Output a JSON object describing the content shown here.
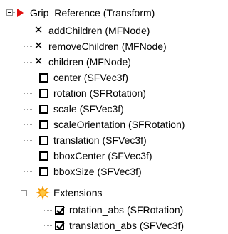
{
  "root": {
    "label": "Grip_Reference (Transform)",
    "icon": "red-triangle-icon",
    "color": "#e01010",
    "expanded": true
  },
  "x_fields": [
    {
      "label": "addChildren (MFNode)",
      "icon": "x-icon"
    },
    {
      "label": "removeChildren (MFNode)",
      "icon": "x-icon"
    },
    {
      "label": "children (MFNode)",
      "icon": "x-icon"
    }
  ],
  "fields": [
    {
      "label": "center (SFVec3f)",
      "checked": false
    },
    {
      "label": "rotation (SFRotation)",
      "checked": false
    },
    {
      "label": "scale (SFVec3f)",
      "checked": false
    },
    {
      "label": "scaleOrientation (SFRotation)",
      "checked": false
    },
    {
      "label": "translation (SFVec3f)",
      "checked": false
    },
    {
      "label": "bboxCenter (SFVec3f)",
      "checked": false
    },
    {
      "label": "bboxSize (SFVec3f)",
      "checked": false
    }
  ],
  "extensions": {
    "label": "Extensions",
    "icon": "orange-burst-icon",
    "color": "#f59a00",
    "expanded": true,
    "items": [
      {
        "label": "rotation_abs (SFRotation)",
        "checked": true
      },
      {
        "label": "translation_abs (SFVec3f)",
        "checked": true
      }
    ]
  }
}
